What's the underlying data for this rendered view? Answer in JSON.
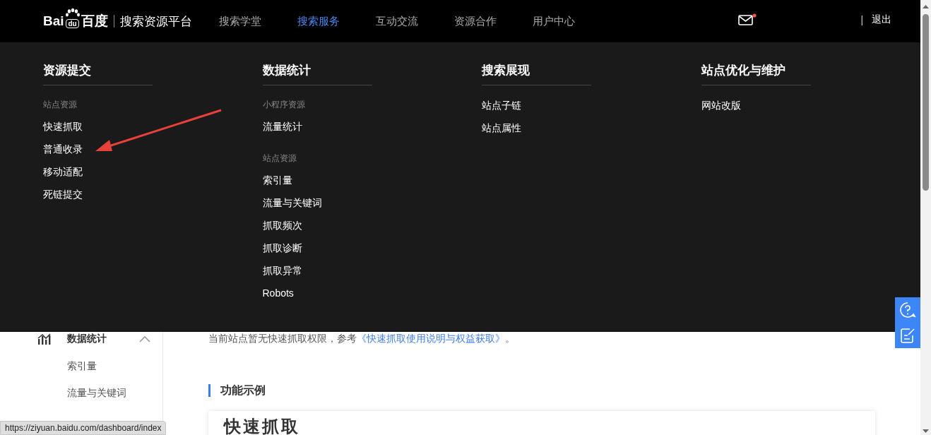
{
  "header": {
    "logo": {
      "prefix": "Bai",
      "badge": "du",
      "suffix": "百度"
    },
    "platform": "搜索资源平台",
    "nav": [
      {
        "label": "搜索学堂",
        "selected": false
      },
      {
        "label": "搜索服务",
        "selected": true
      },
      {
        "label": "互动交流",
        "selected": false
      },
      {
        "label": "资源合作",
        "selected": false
      },
      {
        "label": "用户中心",
        "selected": false
      }
    ],
    "mail_unread": true,
    "separator": "|",
    "logout": "退出"
  },
  "mega_menu": [
    {
      "title": "资源提交",
      "items": [
        {
          "kind": "group",
          "label": "站点资源"
        },
        {
          "kind": "link",
          "label": "快速抓取"
        },
        {
          "kind": "link",
          "label": "普通收录"
        },
        {
          "kind": "link",
          "label": "移动适配"
        },
        {
          "kind": "link",
          "label": "死链提交"
        }
      ]
    },
    {
      "title": "数据统计",
      "items": [
        {
          "kind": "group",
          "label": "小程序资源"
        },
        {
          "kind": "link",
          "label": "流量统计"
        },
        {
          "kind": "group",
          "label": "站点资源"
        },
        {
          "kind": "link",
          "label": "索引量"
        },
        {
          "kind": "link",
          "label": "流量与关键词"
        },
        {
          "kind": "link",
          "label": "抓取频次"
        },
        {
          "kind": "link",
          "label": "抓取诊断"
        },
        {
          "kind": "link",
          "label": "抓取异常"
        },
        {
          "kind": "link",
          "label": "Robots"
        }
      ]
    },
    {
      "title": "搜索展现",
      "items": [
        {
          "kind": "link",
          "label": "站点子链"
        },
        {
          "kind": "link",
          "label": "站点属性"
        }
      ]
    },
    {
      "title": "站点优化与维护",
      "items": [
        {
          "kind": "link",
          "label": "网站改版"
        }
      ]
    }
  ],
  "sidebar": {
    "section": {
      "label": "数据统计",
      "expanded": true
    },
    "items": [
      "索引量",
      "流量与关键词"
    ]
  },
  "content": {
    "notice": {
      "text": "当前站点暂无快速抓取权限，参考",
      "link": "《快速抓取使用说明与权益获取》",
      "end": "。"
    },
    "section_title": "功能示例",
    "example_title": "快速抓取"
  },
  "status_url": "https://ziyuan.baidu.com/dashboard/index"
}
